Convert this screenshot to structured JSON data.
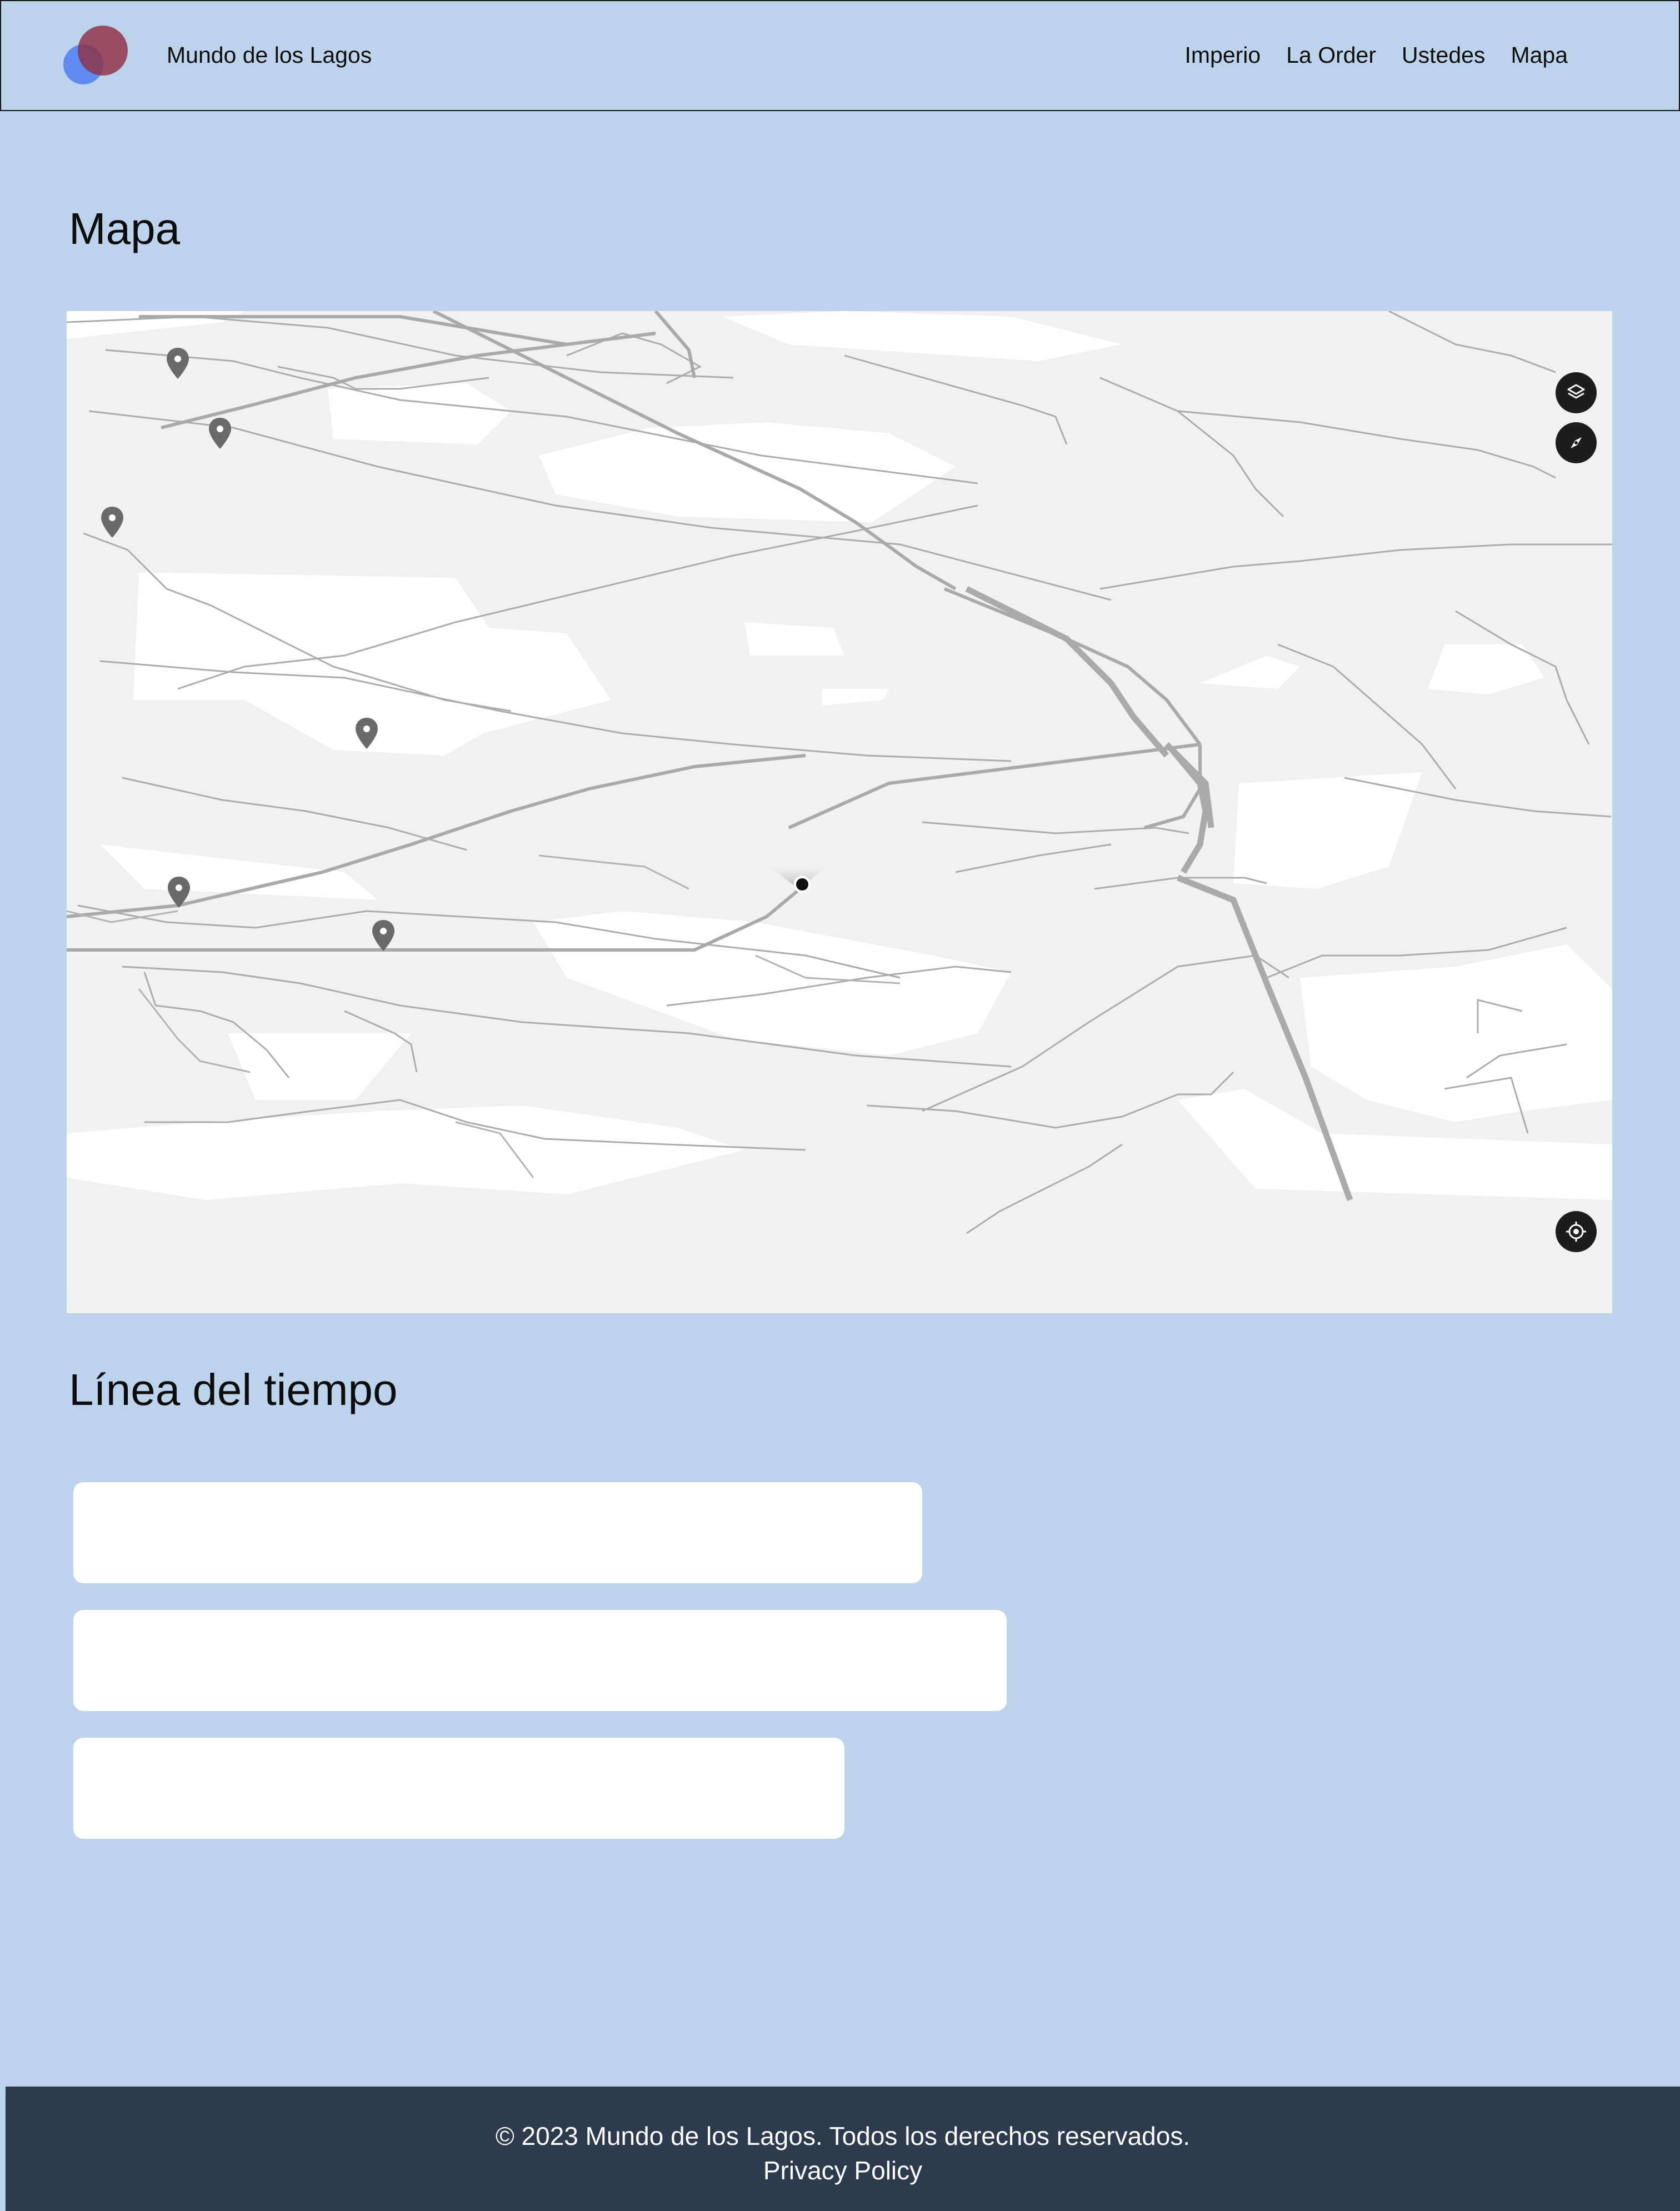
{
  "header": {
    "site_name": "Mundo de los Lagos",
    "nav": [
      "Imperio",
      "La Order",
      "Ustedes",
      "Mapa"
    ]
  },
  "map_section": {
    "title": "Mapa",
    "controls": [
      "layers-icon",
      "compass-icon",
      "locate-icon"
    ],
    "markers": 6
  },
  "timeline": {
    "title": "Línea del tiempo",
    "cards": 3
  },
  "footer": {
    "copyright": "© 2023 Mundo de los Lagos. Todos los derechos reservados.",
    "privacy": "Privacy Policy"
  },
  "colors": {
    "page_bg": "#bbd4eb",
    "footer_bg": "#2c3b4e",
    "map_bg": "#f1f1f1",
    "road": "#a9a9a9"
  }
}
